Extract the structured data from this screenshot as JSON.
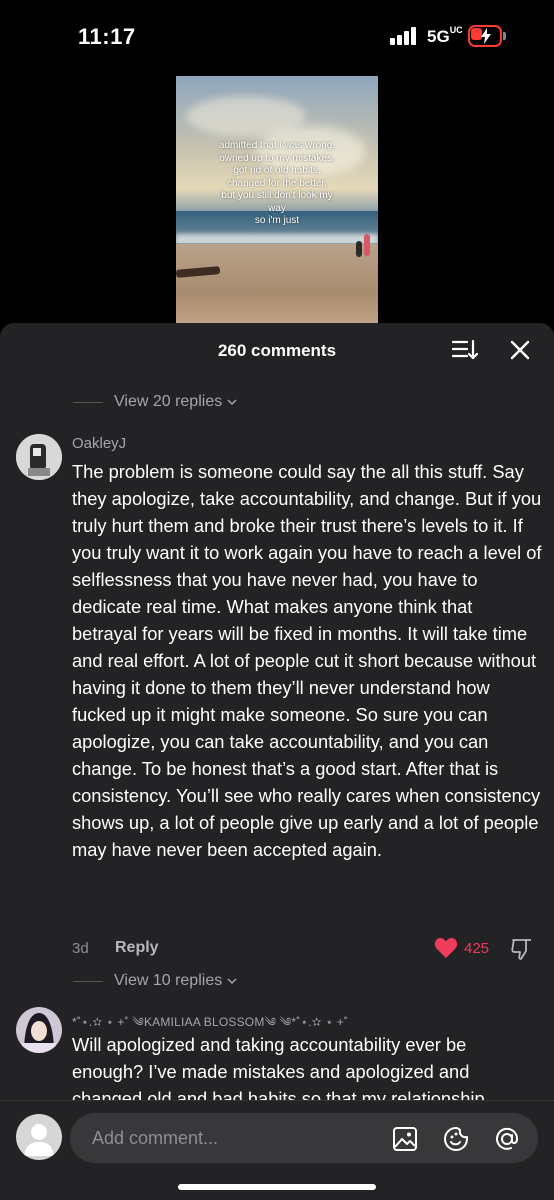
{
  "status_bar": {
    "time": "11:17",
    "network": "5G",
    "network_sup": "UC"
  },
  "video": {
    "overlay_text": "admitted that i was wrong,\nowned up to my mistakes,\ngot rid of old habits,\nchanged for the better,\nbut you still don't look my\nway\nso i'm just"
  },
  "comments_sheet": {
    "title": "260 comments",
    "first_view_replies": "View 20 replies",
    "comments": [
      {
        "username": "OakleyJ",
        "text": "The problem is someone could say the all this stuff. Say they apologize, take accountability, and change. But if you truly hurt them and broke their trust there’s levels to it. If you truly want it to work again you have to reach a level of selflessness that you have never had, you have to dedicate real time. What makes anyone think that betrayal for years will be fixed in months. It will take time and real effort. A lot of people cut it short because without having it done to them they’ll never understand how fucked up it might make someone. So sure you can apologize, you can take accountability, and you can change. To be honest that’s a good start. After that is consistency. You’ll see who really cares when consistency shows up, a lot of people give up early and a lot of people may have never been accepted again.",
        "age": "3d",
        "reply_label": "Reply",
        "likes": "425",
        "view_replies": "View 10 replies"
      },
      {
        "username": "*˚⋆.✫ ⋆ +˚ ༄KAMILIAA BLOSSOM༄ ༄*˚⋆.✫ ⋆ +˚",
        "text": "Will apologized and taking accountability ever be enough? I’ve made mistakes and apologized and changed old and bad habits so that my relationship"
      }
    ]
  },
  "input_bar": {
    "placeholder": "Add comment..."
  },
  "colors": {
    "sheet_bg": "#232325",
    "like_red": "#f03c5b",
    "battery_red": "#ff3b30"
  }
}
